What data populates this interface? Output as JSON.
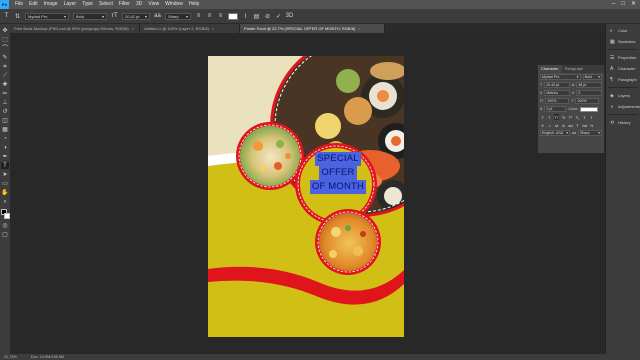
{
  "app": {
    "logo": "Ps",
    "menu": [
      "File",
      "Edit",
      "Image",
      "Layer",
      "Type",
      "Select",
      "Filter",
      "3D",
      "View",
      "Window",
      "Help"
    ],
    "window_controls": [
      "–",
      "□",
      "✕"
    ]
  },
  "options_bar": {
    "font_family": "Myriad Pro",
    "font_style": "Bold",
    "font_size": "20.42 pt",
    "antialias": "Sharp",
    "text_color": "#ffffff"
  },
  "tabs": [
    {
      "label": "Free Book Mockup (PSD.psd @ 50% (progcopy Grimes, RGB/8)",
      "active": false
    },
    {
      "label": "Untitled-1 @ 100% (Layer 2, RGB/8)",
      "active": false
    },
    {
      "label": "Poster Food @ 22.7% (SPECIAL OFFER OF MONTH, RGB/8)",
      "active": true
    }
  ],
  "toolbar": {
    "tools": [
      {
        "name": "move-tool",
        "glyph": "✥"
      },
      {
        "name": "marquee-tool",
        "glyph": "⬚"
      },
      {
        "name": "lasso-tool",
        "glyph": "⌒"
      },
      {
        "name": "quick-select-tool",
        "glyph": "✎"
      },
      {
        "name": "crop-tool",
        "glyph": "⌗"
      },
      {
        "name": "eyedropper-tool",
        "glyph": "⟋"
      },
      {
        "name": "healing-tool",
        "glyph": "✚"
      },
      {
        "name": "brush-tool",
        "glyph": "✏"
      },
      {
        "name": "stamp-tool",
        "glyph": "⊥"
      },
      {
        "name": "history-brush-tool",
        "glyph": "↺"
      },
      {
        "name": "eraser-tool",
        "glyph": "◫"
      },
      {
        "name": "gradient-tool",
        "glyph": "▦"
      },
      {
        "name": "blur-tool",
        "glyph": "◔"
      },
      {
        "name": "dodge-tool",
        "glyph": "◑"
      },
      {
        "name": "pen-tool",
        "glyph": "✒"
      },
      {
        "name": "type-tool",
        "glyph": "T"
      },
      {
        "name": "path-select-tool",
        "glyph": "➤"
      },
      {
        "name": "shape-tool",
        "glyph": "▭"
      },
      {
        "name": "hand-tool",
        "glyph": "✋"
      },
      {
        "name": "zoom-tool",
        "glyph": "⌕"
      }
    ],
    "active_tool": "type-tool"
  },
  "poster": {
    "headline_lines": [
      "SPECIAL",
      "OFFER",
      "OF MONTH"
    ],
    "bg_top": "#eae2bf",
    "bg_main": "#d2bf15",
    "ring_color": "#e0151b"
  },
  "dock": {
    "group1": [
      "Color",
      "Swatches"
    ],
    "group2": [
      "Properties",
      "Character",
      "Paragraph"
    ],
    "group3": [
      "Layers",
      "Adjustments"
    ],
    "group4": [
      "History"
    ]
  },
  "character_panel": {
    "tabs": [
      "Character",
      "Paragraph"
    ],
    "font_family": "Myriad Pro",
    "font_style": "Bold",
    "font_size": "20.42 pt",
    "leading": "48 pt",
    "kerning": "Metrics",
    "tracking": "0",
    "scale_v": "100%",
    "scale_h": "100%",
    "baseline": "0 pt",
    "color_label": "Color:",
    "language": "English: USA",
    "antialias": "Sharp",
    "style_buttons": [
      "T",
      "T",
      "TT",
      "Tt",
      "T¹",
      "T₁",
      "T",
      "T"
    ],
    "opentype_buttons": [
      "fi",
      "ℴ",
      "st",
      "A",
      "ad",
      "T",
      "1st",
      "½"
    ]
  },
  "status": {
    "zoom": "22.73%",
    "doc_size": "Doc: 24.9M/136.9M"
  }
}
